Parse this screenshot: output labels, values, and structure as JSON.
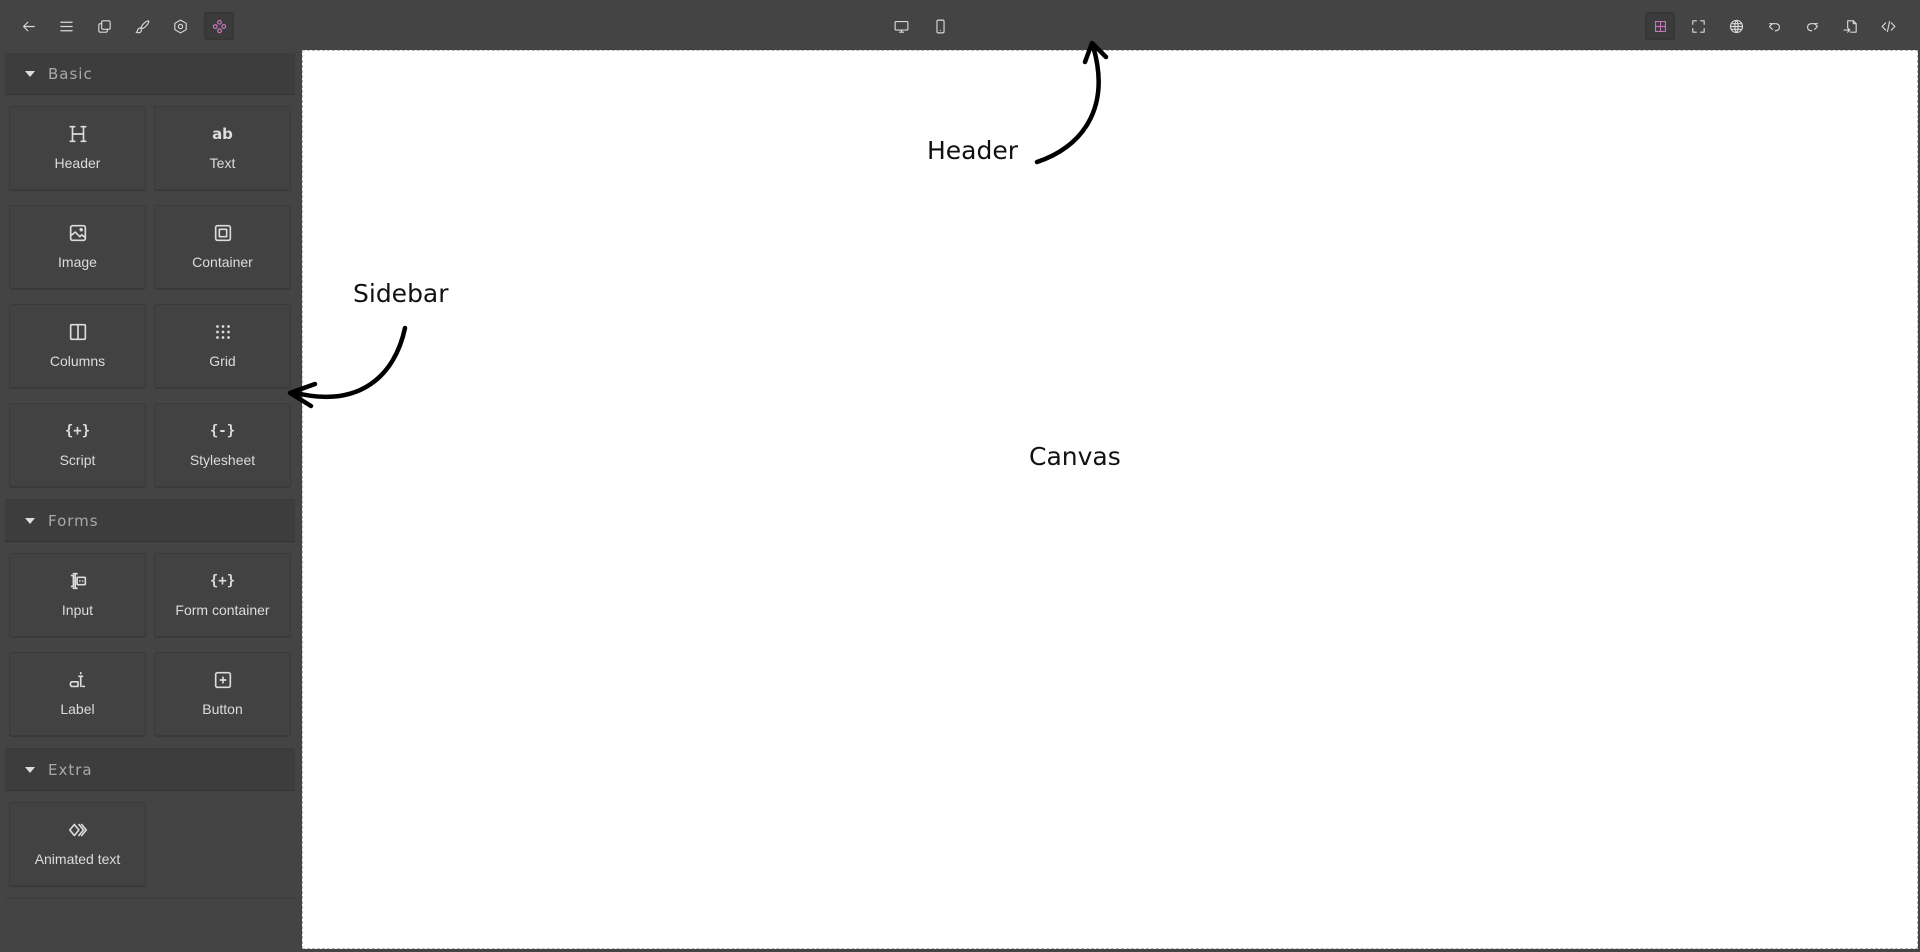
{
  "topbar": {
    "left_buttons": [
      {
        "icon": "arrow-left-icon",
        "label": "Back"
      },
      {
        "icon": "menu-icon",
        "label": "Menu"
      },
      {
        "icon": "pages-icon",
        "label": "Pages"
      },
      {
        "icon": "brush-icon",
        "label": "Style manager"
      },
      {
        "icon": "settings-hex-icon",
        "label": "Settings"
      },
      {
        "icon": "blocks-icon",
        "label": "Blocks",
        "active": true
      }
    ],
    "device_buttons": [
      {
        "icon": "desktop-icon",
        "label": "Desktop"
      },
      {
        "icon": "mobile-icon",
        "label": "Mobile"
      }
    ],
    "right_buttons": [
      {
        "icon": "component-outline-icon",
        "label": "View components",
        "active": true
      },
      {
        "icon": "fullscreen-icon",
        "label": "Fullscreen"
      },
      {
        "icon": "globe-icon",
        "label": "Preview"
      },
      {
        "icon": "undo-icon",
        "label": "Undo"
      },
      {
        "icon": "redo-icon",
        "label": "Redo"
      },
      {
        "icon": "import-icon",
        "label": "Import"
      },
      {
        "icon": "code-icon",
        "label": "View code"
      }
    ],
    "accent_color": "#d278c9"
  },
  "sidebar": {
    "categories": [
      {
        "title": "Basic",
        "blocks": [
          {
            "label": "Header",
            "icon": "heading-icon"
          },
          {
            "label": "Text",
            "icon": "text-ab-icon"
          },
          {
            "label": "Image",
            "icon": "image-icon"
          },
          {
            "label": "Container",
            "icon": "container-icon"
          },
          {
            "label": "Columns",
            "icon": "columns-icon"
          },
          {
            "label": "Grid",
            "icon": "grid-dots-icon"
          },
          {
            "label": "Script",
            "icon": "script-braces-icon"
          },
          {
            "label": "Stylesheet",
            "icon": "stylesheet-braces-icon"
          }
        ]
      },
      {
        "title": "Forms",
        "blocks": [
          {
            "label": "Input",
            "icon": "input-cursor-icon"
          },
          {
            "label": "Form container",
            "icon": "form-braces-icon"
          },
          {
            "label": "Label",
            "icon": "label-icon"
          },
          {
            "label": "Button",
            "icon": "button-plus-icon"
          }
        ]
      },
      {
        "title": "Extra",
        "blocks": [
          {
            "label": "Animated text",
            "icon": "animated-text-icon"
          }
        ]
      }
    ]
  },
  "annotations": {
    "header": "Header",
    "sidebar": "Sidebar",
    "canvas": "Canvas"
  }
}
